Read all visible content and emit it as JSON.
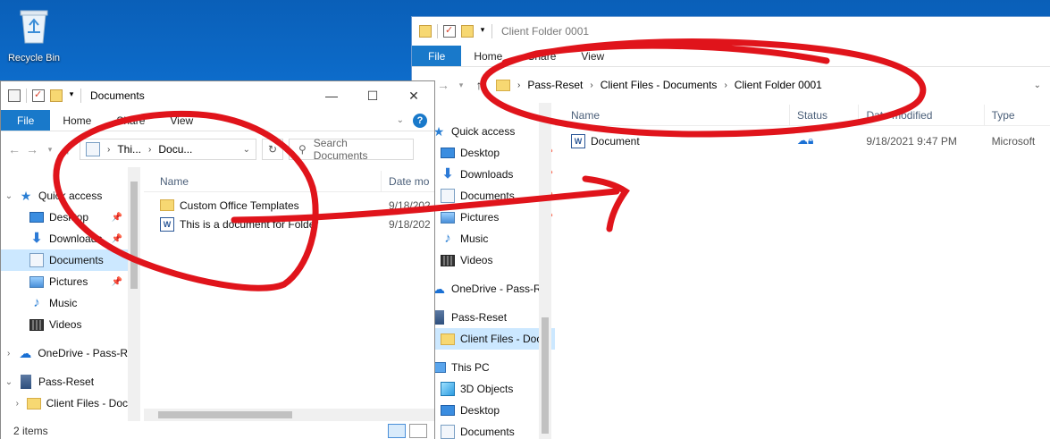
{
  "desktop": {
    "recycle_label": "Recycle Bin"
  },
  "window_back": {
    "title": "Client Folder 0001",
    "ribbon": {
      "file": "File",
      "home": "Home",
      "share": "Share",
      "view": "View"
    },
    "breadcrumb": [
      "Pass-Reset",
      "Client Files - Documents",
      "Client Folder 0001"
    ],
    "nav": [
      {
        "label": "Quick access",
        "icon": "star-icon"
      },
      {
        "label": "Desktop",
        "icon": "desktop-icon"
      },
      {
        "label": "Downloads",
        "icon": "download-icon"
      },
      {
        "label": "Documents",
        "icon": "documents-icon"
      },
      {
        "label": "Pictures",
        "icon": "pictures-icon"
      },
      {
        "label": "Music",
        "icon": "music-icon"
      },
      {
        "label": "Videos",
        "icon": "videos-icon"
      },
      {
        "label": "OneDrive - Pass-R",
        "icon": "onedrive-icon"
      },
      {
        "label": "Pass-Reset",
        "icon": "organization-icon"
      },
      {
        "label": "Client Files - Doc",
        "icon": "folder-icon"
      },
      {
        "label": "This PC",
        "icon": "pc-icon"
      },
      {
        "label": "3D Objects",
        "icon": "3d-objects-icon"
      },
      {
        "label": "Desktop",
        "icon": "desktop-icon"
      },
      {
        "label": "Documents",
        "icon": "documents-icon"
      }
    ],
    "columns": {
      "name": "Name",
      "status": "Status",
      "date": "Date modified",
      "type": "Type"
    },
    "files": [
      {
        "name": "Document",
        "status_icon": "cloud-sync-icon",
        "date": "9/18/2021 9:47 PM",
        "type": "Microsoft"
      }
    ]
  },
  "window_front": {
    "title": "Documents",
    "ribbon": {
      "file": "File",
      "home": "Home",
      "share": "Share",
      "view": "View"
    },
    "breadcrumb": [
      "Thi...",
      "Docu..."
    ],
    "search_placeholder": "Search Documents",
    "nav": [
      {
        "label": "Quick access",
        "icon": "star-icon"
      },
      {
        "label": "Desktop",
        "icon": "desktop-icon"
      },
      {
        "label": "Downloads",
        "icon": "download-icon"
      },
      {
        "label": "Documents",
        "icon": "documents-icon"
      },
      {
        "label": "Pictures",
        "icon": "pictures-icon"
      },
      {
        "label": "Music",
        "icon": "music-icon"
      },
      {
        "label": "Videos",
        "icon": "videos-icon"
      },
      {
        "label": "OneDrive - Pass-R",
        "icon": "onedrive-icon"
      },
      {
        "label": "Pass-Reset",
        "icon": "organization-icon"
      },
      {
        "label": "Client Files - Doc",
        "icon": "folder-icon"
      }
    ],
    "columns": {
      "name": "Name",
      "date": "Date mo"
    },
    "files": [
      {
        "name": "Custom Office Templates",
        "date": "9/18/202",
        "icon": "folder-icon"
      },
      {
        "name": "This is a document for Folder",
        "date": "9/18/202",
        "icon": "word-document-icon"
      }
    ],
    "status": "2 items"
  },
  "colors": {
    "accent": "#1979ca",
    "selection": "#cce8ff",
    "annotation": "#e0141b"
  }
}
